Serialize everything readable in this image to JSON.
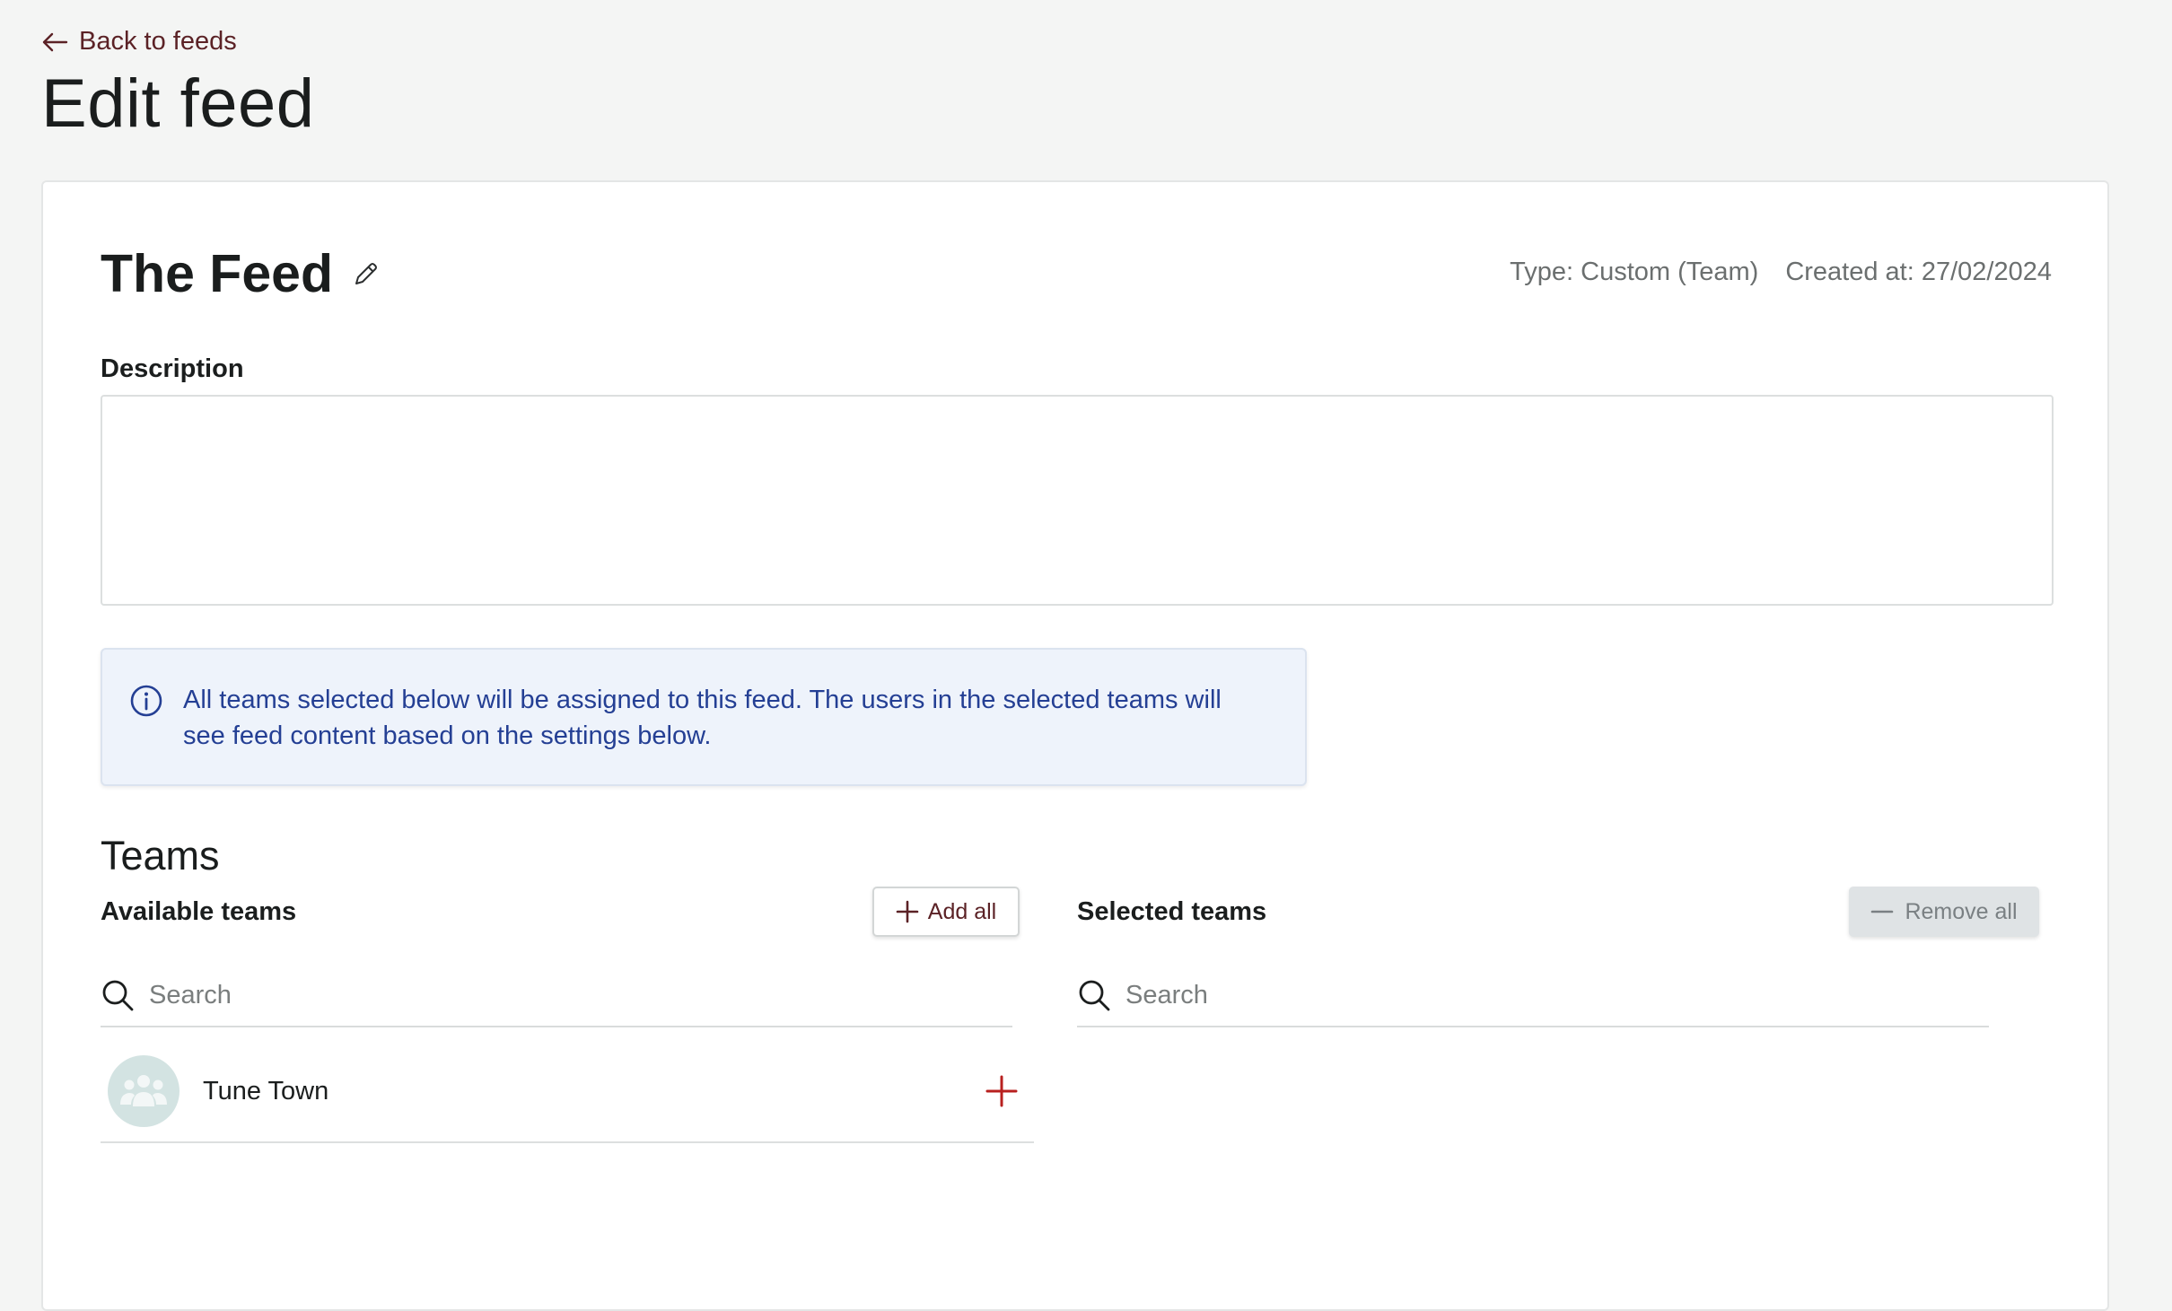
{
  "nav": {
    "back_label": "Back to feeds"
  },
  "page": {
    "title": "Edit feed"
  },
  "feed": {
    "name": "The Feed",
    "type_label": "Type: Custom (Team)",
    "created_label": "Created at: 27/02/2024"
  },
  "description": {
    "label": "Description",
    "value": ""
  },
  "info": {
    "message_line1": "All teams selected below will be assigned to this feed. The users in the selected teams will",
    "message_line2": "see feed content based on the settings below."
  },
  "teams": {
    "heading": "Teams",
    "available": {
      "title": "Available teams",
      "add_all_label": "Add all",
      "search_placeholder": "Search",
      "items": [
        {
          "name": "Tune Town"
        }
      ]
    },
    "selected": {
      "title": "Selected teams",
      "remove_all_label": "Remove all",
      "search_placeholder": "Search",
      "items": []
    }
  },
  "colors": {
    "accent": "#5b2226",
    "add_icon": "#b8201f",
    "info_text": "#243f94",
    "info_bg": "#eef3fb"
  }
}
